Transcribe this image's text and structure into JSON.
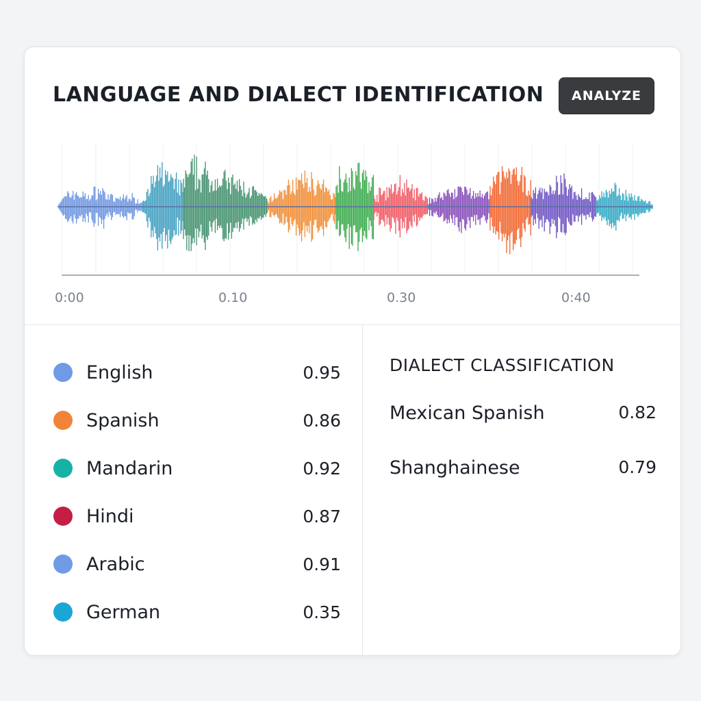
{
  "header": {
    "title": "LANGUAGE AND DIALECT IDENTIFICATION",
    "analyze_label": "ANALYZE"
  },
  "waveform": {
    "time_labels": [
      "0:00",
      "0.10",
      "0.30",
      "0:40"
    ],
    "segments": [
      {
        "color": "#6b93e0",
        "amplitude": 0.55
      },
      {
        "color": "#3d9dbf",
        "amplitude": 1.0
      },
      {
        "color": "#3f8f6b",
        "amplitude": 1.0
      },
      {
        "color": "#f08a30",
        "amplitude": 0.8
      },
      {
        "color": "#38a84a",
        "amplitude": 1.0
      },
      {
        "color": "#ef5560",
        "amplitude": 0.7
      },
      {
        "color": "#8348b8",
        "amplitude": 0.6
      },
      {
        "color": "#f2622a",
        "amplitude": 1.0
      },
      {
        "color": "#6a4fc0",
        "amplitude": 0.65
      },
      {
        "color": "#2fa6c4",
        "amplitude": 0.55
      }
    ]
  },
  "languages": [
    {
      "name": "English",
      "score": "0.95",
      "color": "#6f9be6"
    },
    {
      "name": "Spanish",
      "score": "0.86",
      "color": "#f2843a"
    },
    {
      "name": "Mandarin",
      "score": "0.92",
      "color": "#15b3a6"
    },
    {
      "name": "Hindi",
      "score": "0.87",
      "color": "#c41e45"
    },
    {
      "name": "Arabic",
      "score": "0.91",
      "color": "#6f9be6"
    },
    {
      "name": "German",
      "score": "0.35",
      "color": "#1aa7d6"
    }
  ],
  "dialects": {
    "title": "DIALECT CLASSIFICATION",
    "items": [
      {
        "name": "Mexican Spanish",
        "score": "0.82"
      },
      {
        "name": "Shanghainese",
        "score": "0.79"
      }
    ]
  }
}
